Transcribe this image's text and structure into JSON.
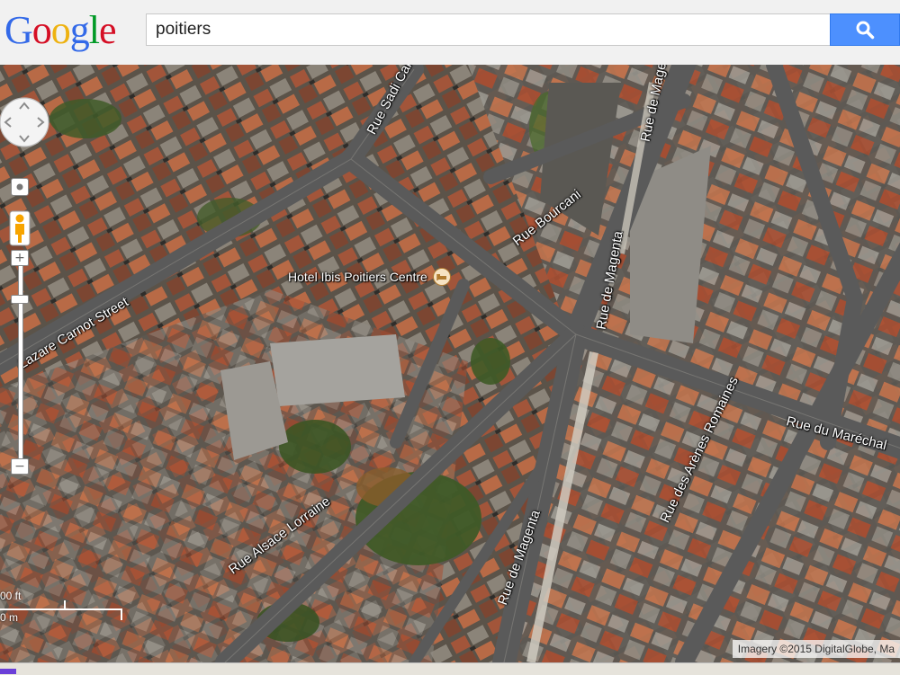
{
  "header": {
    "logo_letters": [
      "G",
      "o",
      "o",
      "g",
      "l",
      "e"
    ],
    "logo_colors": [
      "#3369e8",
      "#d50f25",
      "#eeb211",
      "#3369e8",
      "#009925",
      "#d50f25"
    ],
    "search_value": "poitiers",
    "search_icon": "search-icon",
    "accent_color": "#4d90fe"
  },
  "map": {
    "type": "satellite",
    "streets": [
      "Rue Sadi Carnot",
      "Rue de Magenta",
      "Rue Bourcani",
      "Lazare Carnot Street",
      "Rue de Magenta",
      "Rue des Arènes Romaines",
      "Rue du Maréchal",
      "Rue Alsace Lorraine",
      "Rue de Magenta"
    ],
    "poi": {
      "label": "Hotel Ibis Poitiers Centre",
      "icon": "hotel-icon"
    },
    "scale": {
      "feet": "00 ft",
      "meters": "0 m"
    },
    "attribution": "Imagery ©2015 DigitalGlobe, Ma"
  },
  "controls": {
    "pan_icon": "pan-control-icon",
    "pegman_icon": "pegman-icon",
    "zoom_in": "+",
    "zoom_out": "−",
    "zoom_level_fraction": 0.18
  }
}
